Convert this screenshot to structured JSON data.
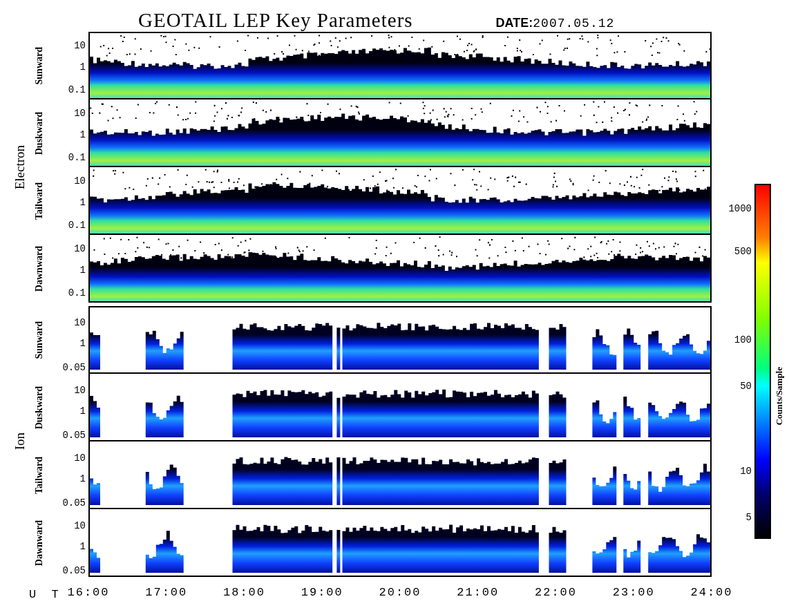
{
  "title": "GEOTAIL LEP Key Parameters",
  "date": {
    "label": "DATE:",
    "value": "2007.05.12"
  },
  "groups": [
    {
      "label": "Electron",
      "kind": "electron",
      "panels": [
        {
          "label": "Sunward",
          "y_ticks": [
            "10",
            "1",
            "0.1"
          ]
        },
        {
          "label": "Duskward",
          "y_ticks": [
            "10",
            "1",
            "0.1"
          ]
        },
        {
          "label": "Tailward",
          "y_ticks": [
            "10",
            "1",
            "0.1"
          ]
        },
        {
          "label": "Dawnward",
          "y_ticks": [
            "10",
            "1",
            "0.1"
          ]
        }
      ]
    },
    {
      "label": "Ion",
      "kind": "ion",
      "panels": [
        {
          "label": "Sunward",
          "y_ticks": [
            "10",
            "1",
            "0.05"
          ]
        },
        {
          "label": "Duskward",
          "y_ticks": [
            "10",
            "1",
            "0.05"
          ]
        },
        {
          "label": "Tailward",
          "y_ticks": [
            "10",
            "1",
            "0.05"
          ]
        },
        {
          "label": "Dawnward",
          "y_ticks": [
            "10",
            "1",
            "0.05"
          ]
        }
      ]
    }
  ],
  "x_axis": {
    "label": "U T",
    "ticks": [
      "16:00",
      "17:00",
      "18:00",
      "19:00",
      "20:00",
      "21:00",
      "22:00",
      "23:00",
      "24:00"
    ]
  },
  "colorbar": {
    "label": "Counts/Sample",
    "ticks": [
      "1000",
      "500",
      "100",
      "50",
      "10",
      "5"
    ]
  }
}
